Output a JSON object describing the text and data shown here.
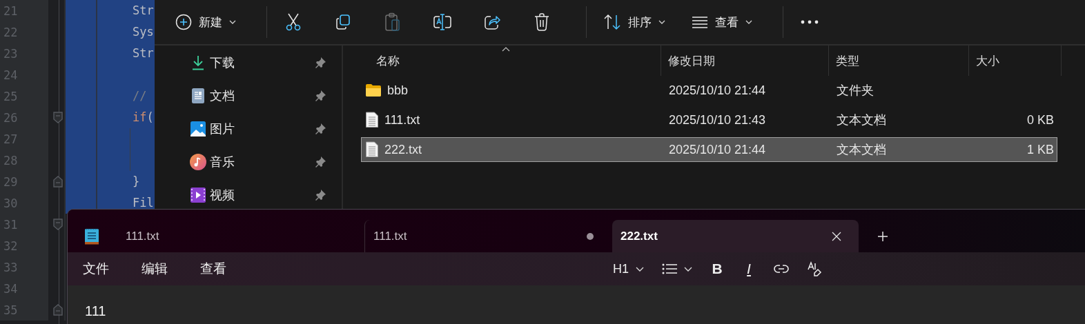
{
  "code_editor": {
    "lines": [
      {
        "number": "21",
        "selected": true,
        "tokens": [
          {
            "text": "Str",
            "kind": "plain"
          }
        ]
      },
      {
        "number": "22",
        "selected": true,
        "tokens": [
          {
            "text": "Sys",
            "kind": "plain"
          }
        ]
      },
      {
        "number": "23",
        "selected": true,
        "tokens": [
          {
            "text": "Str",
            "kind": "plain"
          }
        ]
      },
      {
        "number": "24",
        "selected": true
      },
      {
        "number": "25",
        "selected": true,
        "tokens": [
          {
            "text": "//",
            "kind": "comment"
          }
        ]
      },
      {
        "number": "26",
        "selected": true,
        "kind": "opener",
        "tokens": [
          {
            "text": "if",
            "kind": "keyword"
          },
          {
            "text": "(",
            "kind": "plain"
          }
        ]
      },
      {
        "number": "27",
        "selected": true,
        "guide": true
      },
      {
        "number": "28",
        "selected": true,
        "guide": true
      },
      {
        "number": "29",
        "selected": true,
        "kind": "closer",
        "tokens": [
          {
            "text": "}",
            "kind": "plain"
          }
        ]
      },
      {
        "number": "30",
        "selected": true,
        "tokens": [
          {
            "text": "Fil",
            "kind": "plain"
          }
        ]
      },
      {
        "number": "31",
        "kind": "opener"
      },
      {
        "number": "32"
      },
      {
        "number": "33"
      },
      {
        "number": "34"
      },
      {
        "number": "35",
        "kind": "closer"
      }
    ]
  },
  "explorer": {
    "toolbar": [
      {
        "kind": "new",
        "label": "新建",
        "dropdown": true,
        "disabled": false
      },
      {
        "kind": "separator"
      },
      {
        "kind": "cut",
        "disabled": false
      },
      {
        "kind": "copy",
        "disabled": false
      },
      {
        "kind": "paste",
        "disabled": true
      },
      {
        "kind": "rename",
        "disabled": false
      },
      {
        "kind": "share",
        "disabled": false
      },
      {
        "kind": "delete",
        "disabled": false
      },
      {
        "kind": "separator"
      },
      {
        "kind": "sort",
        "label": "排序",
        "dropdown": true,
        "disabled": false
      },
      {
        "kind": "view",
        "label": "查看",
        "dropdown": true,
        "disabled": false
      },
      {
        "kind": "separator"
      },
      {
        "kind": "more",
        "disabled": false
      }
    ],
    "sidebar": {
      "items": [
        {
          "kind": "downloads",
          "label": "下载",
          "pinned": true
        },
        {
          "kind": "documents",
          "label": "文档",
          "pinned": true
        },
        {
          "kind": "pictures",
          "label": "图片",
          "pinned": true
        },
        {
          "kind": "music",
          "label": "音乐",
          "pinned": true
        },
        {
          "kind": "videos",
          "label": "视频",
          "pinned": true
        }
      ]
    },
    "file_list": {
      "columns": [
        {
          "label": "名称",
          "sorted": true
        },
        {
          "label": "修改日期",
          "sorted": false
        },
        {
          "label": "类型",
          "sorted": false
        },
        {
          "label": "大小",
          "sorted": false
        }
      ],
      "rows": [
        {
          "kind": "folder",
          "name": "bbb",
          "modified": "2025/10/10 21:44",
          "type": "文件夹",
          "selected": false
        },
        {
          "kind": "file",
          "name": "111.txt",
          "modified": "2025/10/10 21:43",
          "type": "文本文档",
          "size": "0 KB",
          "selected": false
        },
        {
          "kind": "file",
          "name": "222.txt",
          "modified": "2025/10/10 21:44",
          "type": "文本文档",
          "size": "1 KB",
          "selected": true
        }
      ]
    }
  },
  "notepad": {
    "tabs": [
      {
        "title": "111.txt",
        "selected": false,
        "modified": false
      },
      {
        "title": "111.txt",
        "selected": false,
        "modified": true
      },
      {
        "title": "222.txt",
        "selected": true
      }
    ],
    "menu": [
      "文件",
      "编辑",
      "查看"
    ],
    "format_toolbar": [
      {
        "kind": "heading",
        "label": "H1",
        "dropdown": true
      },
      {
        "kind": "list",
        "dropdown": true
      },
      {
        "kind": "bold",
        "glyph": "B"
      },
      {
        "kind": "italic",
        "glyph": "I"
      },
      {
        "kind": "link"
      },
      {
        "kind": "clear_formatting"
      }
    ],
    "content": "111"
  }
}
